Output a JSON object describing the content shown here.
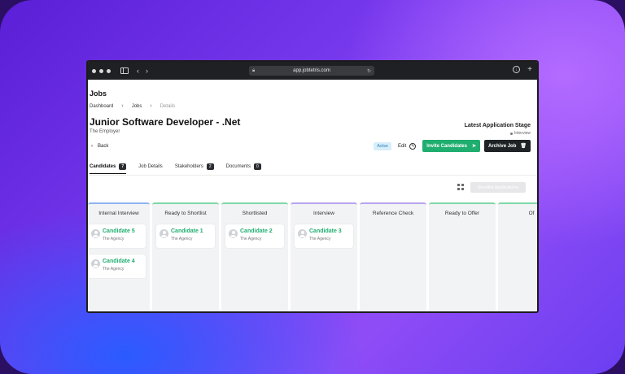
{
  "browser": {
    "url": "app.jobtetris.com"
  },
  "page": {
    "heading": "Jobs",
    "breadcrumb": [
      "Dashboard",
      "Jobs",
      "Details"
    ],
    "job_title": "Junior Software Developer - .Net",
    "employer": "The Employer",
    "latest_stage_title": "Latest Application Stage",
    "latest_stage_value": "Interview",
    "back_label": "Back"
  },
  "actions": {
    "status": "Active",
    "edit": "Edit",
    "invite": "Invite Candidates",
    "archive": "Archive Job"
  },
  "tabs": [
    {
      "label": "Candidates",
      "count": "7"
    },
    {
      "label": "Job Details",
      "count": ""
    },
    {
      "label": "Stakeholders",
      "count": "2"
    },
    {
      "label": "Documents",
      "count": "0"
    }
  ],
  "shortlist_button": "Shortlist Applications",
  "board": {
    "columns": [
      {
        "title": "Internal Interview",
        "color": "#8fb3f0",
        "cards": [
          {
            "name": "Candidate 5",
            "agency": "The Agency"
          },
          {
            "name": "Candidate 4",
            "agency": "The Agency"
          }
        ]
      },
      {
        "title": "Ready to Shortlist",
        "color": "#7fd8a8",
        "cards": [
          {
            "name": "Candidate 1",
            "agency": "The Agency"
          }
        ]
      },
      {
        "title": "Shortlisted",
        "color": "#7fd8a8",
        "cards": [
          {
            "name": "Candidate 2",
            "agency": "The Agency"
          }
        ]
      },
      {
        "title": "Interview",
        "color": "#b8a4ee",
        "cards": [
          {
            "name": "Candidate 3",
            "agency": "The Agency"
          }
        ]
      },
      {
        "title": "Reference Check",
        "color": "#b8a4ee",
        "cards": []
      },
      {
        "title": "Ready to Offer",
        "color": "#7fd8a8",
        "cards": []
      },
      {
        "title": "Of",
        "color": "#7fd8a8",
        "cards": []
      }
    ]
  },
  "colors": {
    "brand_green": "#1fae6f",
    "dark": "#1f2326"
  }
}
